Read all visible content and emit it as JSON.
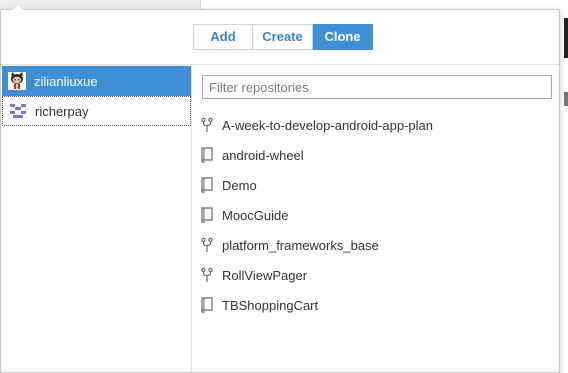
{
  "tabs": [
    {
      "label": "Add",
      "active": false
    },
    {
      "label": "Create",
      "active": false
    },
    {
      "label": "Clone",
      "active": true
    }
  ],
  "accounts": [
    {
      "name": "zilianliuxue",
      "avatar": "octocat-avatar",
      "selected": true
    },
    {
      "name": "richerpay",
      "avatar": "identicon-avatar",
      "selected": false
    }
  ],
  "filter": {
    "placeholder": "Filter repositories",
    "value": ""
  },
  "repositories": [
    {
      "name": "A-week-to-develop-android-app-plan",
      "icon": "fork-icon"
    },
    {
      "name": "android-wheel",
      "icon": "repo-book-icon"
    },
    {
      "name": "Demo",
      "icon": "repo-book-icon"
    },
    {
      "name": "MoocGuide",
      "icon": "repo-book-icon"
    },
    {
      "name": "platform_frameworks_base",
      "icon": "fork-icon"
    },
    {
      "name": "RollViewPager",
      "icon": "fork-icon"
    },
    {
      "name": "TBShoppingCart",
      "icon": "repo-book-icon"
    }
  ],
  "colors": {
    "accent": "#3e8fd6",
    "link": "#3b82c4"
  }
}
